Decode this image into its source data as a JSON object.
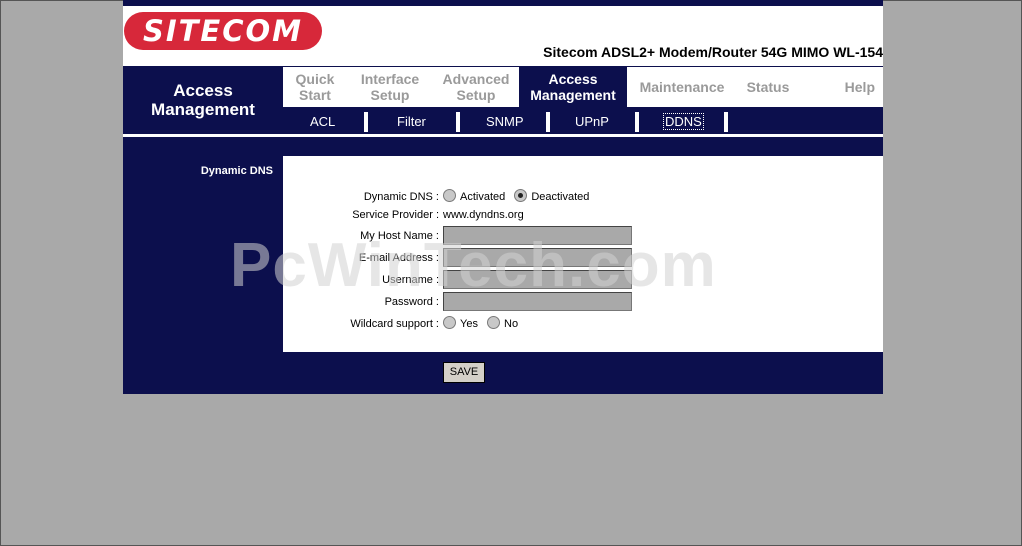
{
  "header": {
    "logo_text": "SITECOM",
    "product_title": "Sitecom ADSL2+ Modem/Router 54G MIMO WL-154"
  },
  "section_title": "Access Management",
  "tabs": [
    {
      "label": "Quick Start",
      "active": false
    },
    {
      "label": "Interface Setup",
      "active": false
    },
    {
      "label": "Advanced Setup",
      "active": false
    },
    {
      "label": "Access Management",
      "active": true
    },
    {
      "label": "Maintenance",
      "active": false
    },
    {
      "label": "Status",
      "active": false
    },
    {
      "label": "Help",
      "active": false
    }
  ],
  "subnav": [
    {
      "label": "ACL"
    },
    {
      "label": "Filter"
    },
    {
      "label": "SNMP"
    },
    {
      "label": "UPnP"
    },
    {
      "label": "DDNS",
      "active": true
    }
  ],
  "panel": {
    "left_label": "Dynamic DNS",
    "dynamic_dns": {
      "label": "Dynamic DNS :",
      "options": [
        "Activated",
        "Deactivated"
      ],
      "selected": "Deactivated"
    },
    "service_provider": {
      "label": "Service Provider :",
      "value": "www.dyndns.org"
    },
    "host_name": {
      "label": "My Host Name :",
      "value": ""
    },
    "email": {
      "label": "E-mail Address :",
      "value": ""
    },
    "username": {
      "label": "Username :",
      "value": ""
    },
    "password": {
      "label": "Password :",
      "value": ""
    },
    "wildcard": {
      "label": "Wildcard support :",
      "options": [
        "Yes",
        "No"
      ],
      "selected": ""
    }
  },
  "save_label": "SAVE",
  "watermark": "PcWinTech.com",
  "colors": {
    "navy": "#0c0f4d",
    "brand_red": "#d7283a",
    "tab_inactive": "#9a9a9a"
  }
}
